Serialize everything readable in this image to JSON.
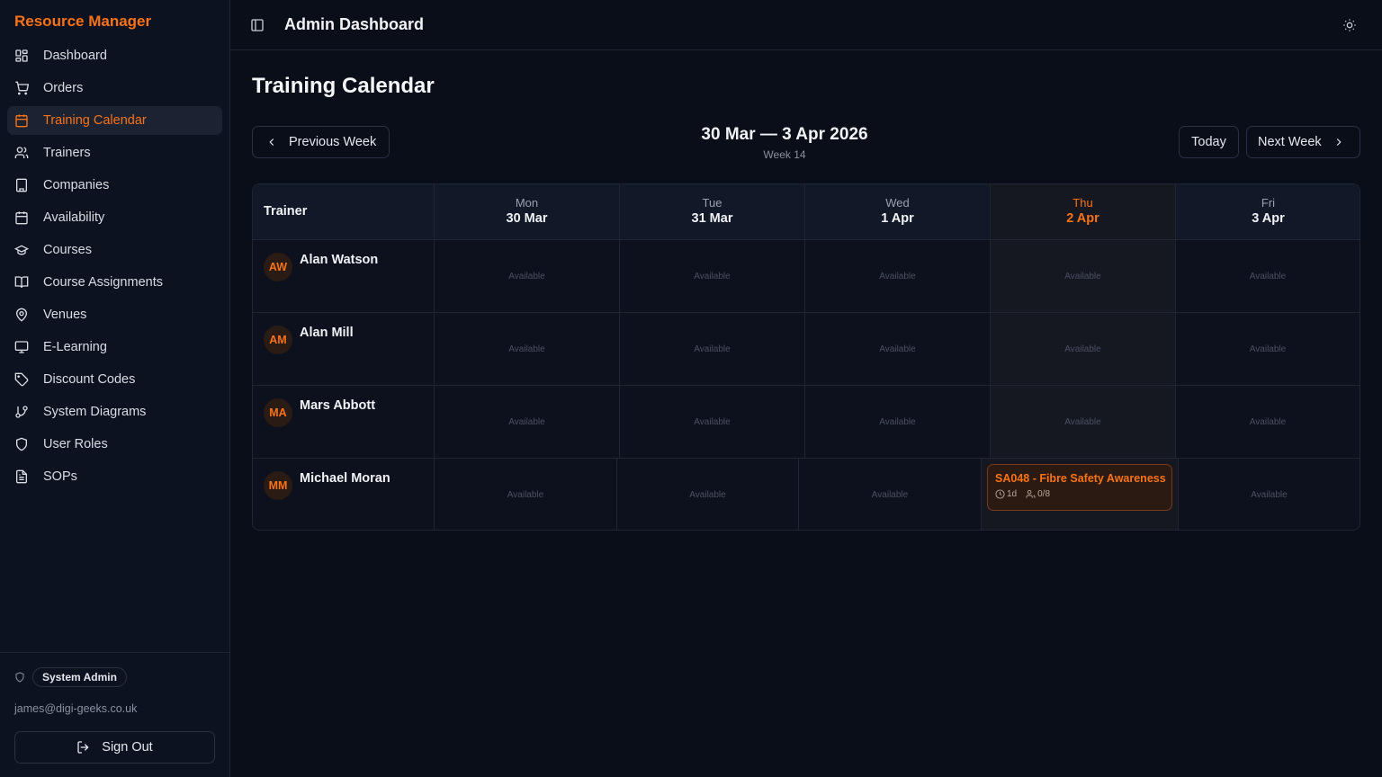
{
  "app": {
    "brand": "Resource Manager",
    "header_title": "Admin Dashboard"
  },
  "sidebar": {
    "items": [
      {
        "label": "Dashboard",
        "icon": "dashboard-icon"
      },
      {
        "label": "Orders",
        "icon": "cart-icon"
      },
      {
        "label": "Training Calendar",
        "icon": "calendar-icon",
        "active": true
      },
      {
        "label": "Trainers",
        "icon": "users-icon"
      },
      {
        "label": "Companies",
        "icon": "building-icon"
      },
      {
        "label": "Availability",
        "icon": "calendar-icon"
      },
      {
        "label": "Courses",
        "icon": "graduation-cap-icon"
      },
      {
        "label": "Course Assignments",
        "icon": "book-open-icon"
      },
      {
        "label": "Venues",
        "icon": "map-pin-icon"
      },
      {
        "label": "E-Learning",
        "icon": "monitor-icon"
      },
      {
        "label": "Discount Codes",
        "icon": "tag-icon"
      },
      {
        "label": "System Diagrams",
        "icon": "git-branch-icon"
      },
      {
        "label": "User Roles",
        "icon": "shield-icon"
      },
      {
        "label": "SOPs",
        "icon": "file-text-icon"
      }
    ],
    "role": "System Admin",
    "email": "james@digi-geeks.co.uk",
    "signout": "Sign Out"
  },
  "page": {
    "title": "Training Calendar",
    "prev_label": "Previous Week",
    "today_label": "Today",
    "next_label": "Next Week",
    "week_range": "30 Mar — 3 Apr 2026",
    "week_number": "Week 14"
  },
  "calendar": {
    "trainer_header": "Trainer",
    "days": [
      {
        "name": "Mon",
        "date": "30 Mar"
      },
      {
        "name": "Tue",
        "date": "31 Mar"
      },
      {
        "name": "Wed",
        "date": "1 Apr"
      },
      {
        "name": "Thu",
        "date": "2 Apr",
        "today": true
      },
      {
        "name": "Fri",
        "date": "3 Apr"
      }
    ],
    "available_label": "Available",
    "trainers": [
      {
        "initials": "AW",
        "name": "Alan Watson"
      },
      {
        "initials": "AM",
        "name": "Alan Mill"
      },
      {
        "initials": "MA",
        "name": "Mars Abbott"
      },
      {
        "initials": "MM",
        "name": "Michael Moran"
      }
    ],
    "event": {
      "title": "SA048 - Fibre Safety Awareness",
      "duration": "1d",
      "attendees": "0/8"
    }
  },
  "colors": {
    "accent": "#f97316",
    "background": "#0a0e18",
    "sidebar": "#0d1220"
  }
}
